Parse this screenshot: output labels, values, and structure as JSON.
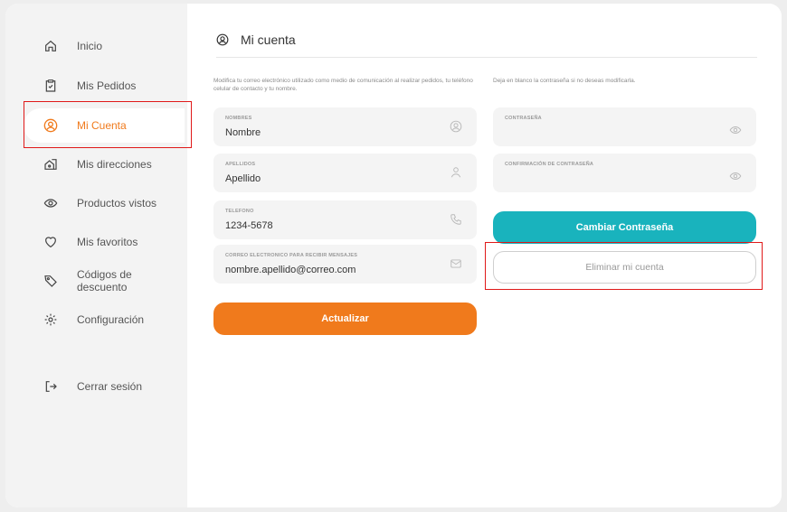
{
  "sidebar": {
    "items": [
      {
        "label": "Inicio",
        "icon": "home-icon"
      },
      {
        "label": "Mis Pedidos",
        "icon": "orders-icon"
      },
      {
        "label": "Mi Cuenta",
        "icon": "user-circle-icon",
        "active": true
      },
      {
        "label": "Mis direcciones",
        "icon": "house-location-icon"
      },
      {
        "label": "Productos vistos",
        "icon": "eye-icon"
      },
      {
        "label": "Mis favoritos",
        "icon": "heart-icon"
      },
      {
        "label": "Códigos de descuento",
        "icon": "tag-icon"
      },
      {
        "label": "Configuración",
        "icon": "gear-icon"
      }
    ],
    "logout_label": "Cerrar sesión"
  },
  "main": {
    "title": "Mi cuenta",
    "left_description": "Modifica tu correo electrónico utilizado como medio de comunicación al realizar pedidos, tu teléfono celular de contacto y tu nombre.",
    "right_description": "Deja en blanco la contraseña si no deseas modificarla.",
    "fields": {
      "nombres": {
        "label": "NOMBRES",
        "value": "Nombre"
      },
      "apellidos": {
        "label": "APELLIDOS",
        "value": "Apellido"
      },
      "telefono": {
        "label": "TELEFONO",
        "value": "1234-5678"
      },
      "correo": {
        "label": "CORREO ELECTRONICO PARA RECIBIR MENSAJES",
        "value": "nombre.apellido@correo.com"
      },
      "contrasena": {
        "label": "CONTRASEÑA",
        "value": ""
      },
      "confirmacion": {
        "label": "CONFIRMACIÓN DE CONTRASEÑA",
        "value": ""
      }
    },
    "buttons": {
      "actualizar": "Actualizar",
      "cambiar": "Cambiar Contraseña",
      "eliminar": "Eliminar mi cuenta"
    }
  },
  "colors": {
    "accent_orange": "#f07a1c",
    "accent_teal": "#19b3bd",
    "highlight_red": "#e01919"
  }
}
